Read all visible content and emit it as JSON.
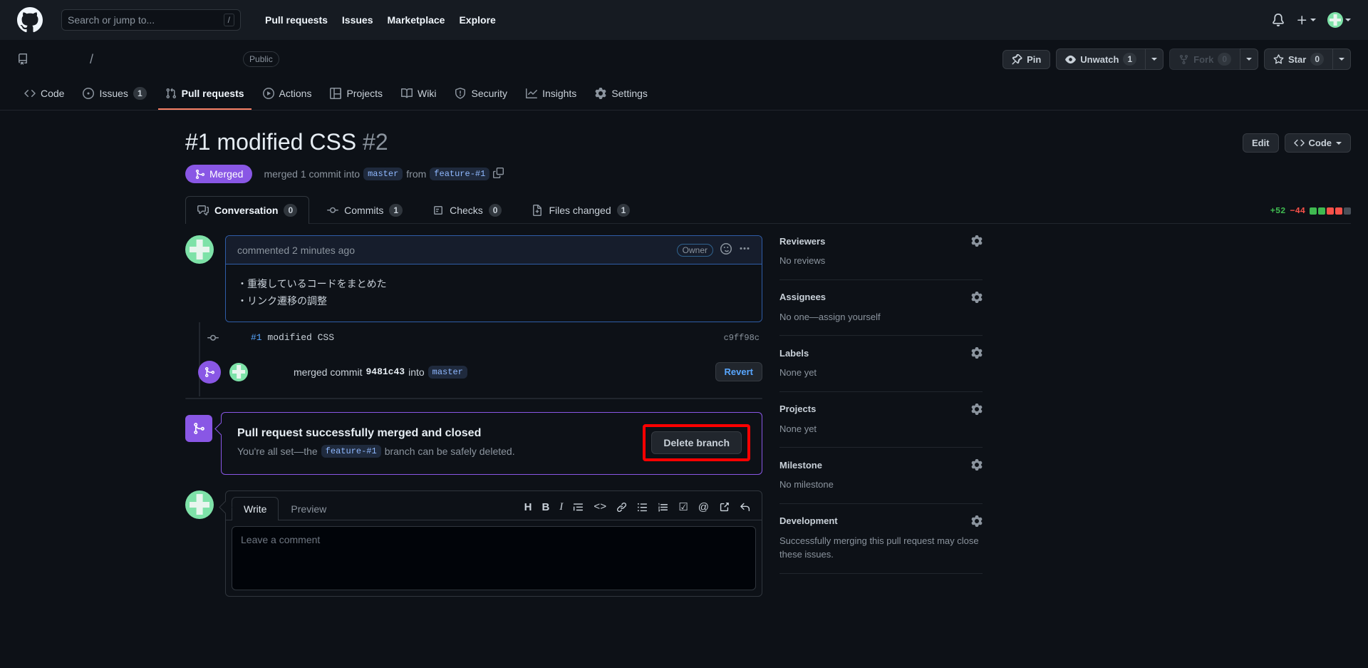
{
  "header": {
    "logo_icon": "github-mark-icon",
    "search": {
      "placeholder": "Search or jump to...",
      "shortcut": "/"
    },
    "nav": [
      {
        "label": "Pull requests"
      },
      {
        "label": "Issues"
      },
      {
        "label": "Marketplace"
      },
      {
        "label": "Explore"
      }
    ],
    "notifications_icon": "bell-icon",
    "create_icon": "plus-icon",
    "account_icon": "avatar"
  },
  "repo": {
    "icon": "repo-icon",
    "owner": "",
    "separator": "/",
    "name": "",
    "visibility": "Public",
    "actions": {
      "pin": "Pin",
      "unwatch": "Unwatch",
      "unwatch_count": "1",
      "fork": "Fork",
      "fork_count": "0",
      "star": "Star",
      "star_count": "0"
    },
    "tabs": [
      {
        "label": "Code",
        "icon": "code-icon",
        "count": null,
        "active": false
      },
      {
        "label": "Issues",
        "icon": "issue-icon",
        "count": "1",
        "active": false
      },
      {
        "label": "Pull requests",
        "icon": "git-pull-icon",
        "count": null,
        "active": true
      },
      {
        "label": "Actions",
        "icon": "play-icon",
        "count": null,
        "active": false
      },
      {
        "label": "Projects",
        "icon": "table-icon",
        "count": null,
        "active": false
      },
      {
        "label": "Wiki",
        "icon": "book-icon",
        "count": null,
        "active": false
      },
      {
        "label": "Security",
        "icon": "shield-icon",
        "count": null,
        "active": false
      },
      {
        "label": "Insights",
        "icon": "graph-icon",
        "count": null,
        "active": false
      },
      {
        "label": "Settings",
        "icon": "gear-icon",
        "count": null,
        "active": false
      }
    ]
  },
  "pr": {
    "title": "#1 modified CSS",
    "number": "#2",
    "edit_label": "Edit",
    "code_label": "Code",
    "state": "Merged",
    "meta_prefix": "merged 1 commit into",
    "base_branch": "master",
    "meta_from": "from",
    "head_branch": "feature-#1",
    "copy_icon": "copy-icon",
    "tabs": [
      {
        "label": "Conversation",
        "icon": "comment-icon",
        "count": "0",
        "active": true
      },
      {
        "label": "Commits",
        "icon": "commit-icon",
        "count": "1",
        "active": false
      },
      {
        "label": "Checks",
        "icon": "checklist-icon",
        "count": "0",
        "active": false
      },
      {
        "label": "Files changed",
        "icon": "file-diff-icon",
        "count": "1",
        "active": false
      }
    ],
    "diffstat": {
      "additions": "+52",
      "deletions": "−44",
      "blocks": [
        "#3fb950",
        "#3fb950",
        "#f85149",
        "#f85149",
        "#484f58"
      ]
    }
  },
  "comment": {
    "meta": "commented 2 minutes ago",
    "role_badge": "Owner",
    "reaction_icon": "smiley-icon",
    "menu_icon": "kebab-icon",
    "body_lines": [
      "・重複しているコードをまとめた",
      "・リンク遷移の調整"
    ]
  },
  "commit_row": {
    "icon": "commit-dot-icon",
    "link_text": "#1",
    "message": " modified CSS",
    "sha": "c9ff98c"
  },
  "merged_row": {
    "icon": "git-merge-icon",
    "text_prefix": "merged commit",
    "commit": "9481c43",
    "text_middle": "into",
    "branch": "master",
    "revert_label": "Revert"
  },
  "merged_banner": {
    "icon": "git-merge-icon",
    "title": "Pull request successfully merged and closed",
    "subtitle_prefix": "You're all set—the",
    "branch": "feature-#1",
    "subtitle_suffix": "branch can be safely deleted.",
    "delete_label": "Delete branch",
    "highlight_color": "#ff0000"
  },
  "write_box": {
    "tabs": [
      {
        "label": "Write",
        "active": true
      },
      {
        "label": "Preview",
        "active": false
      }
    ],
    "toolbar": [
      {
        "icon": "heading-icon",
        "glyph": "H"
      },
      {
        "icon": "bold-icon",
        "glyph": "B"
      },
      {
        "icon": "italic-icon",
        "glyph": "I"
      },
      {
        "icon": "quote-icon",
        "glyph": "❞"
      },
      {
        "icon": "code-icon",
        "glyph": "<>"
      },
      {
        "icon": "link-icon",
        "glyph": "🔗"
      },
      {
        "icon": "unordered-list-icon",
        "glyph": "☰"
      },
      {
        "icon": "ordered-list-icon",
        "glyph": "≡"
      },
      {
        "icon": "task-list-icon",
        "glyph": "☑"
      },
      {
        "icon": "mention-icon",
        "glyph": "@"
      },
      {
        "icon": "reference-icon",
        "glyph": "↗"
      },
      {
        "icon": "reply-icon",
        "glyph": "↩"
      }
    ],
    "placeholder": "Leave a comment"
  },
  "sidebar": [
    {
      "title": "Reviewers",
      "value": "No reviews",
      "gear": "gear-icon"
    },
    {
      "title": "Assignees",
      "value": "No one—assign yourself",
      "gear": "gear-icon"
    },
    {
      "title": "Labels",
      "value": "None yet",
      "gear": "gear-icon"
    },
    {
      "title": "Projects",
      "value": "None yet",
      "gear": "gear-icon"
    },
    {
      "title": "Milestone",
      "value": "No milestone",
      "gear": "gear-icon"
    },
    {
      "title": "Development",
      "value": "Successfully merging this pull request may close these issues.",
      "gear": "gear-icon"
    }
  ],
  "colors": {
    "bg": "#0d1117",
    "header_bg": "#161b22",
    "merged_purple": "#8957e5",
    "accent_blue": "#58a6ff",
    "active_tab_underline": "#f78166"
  }
}
